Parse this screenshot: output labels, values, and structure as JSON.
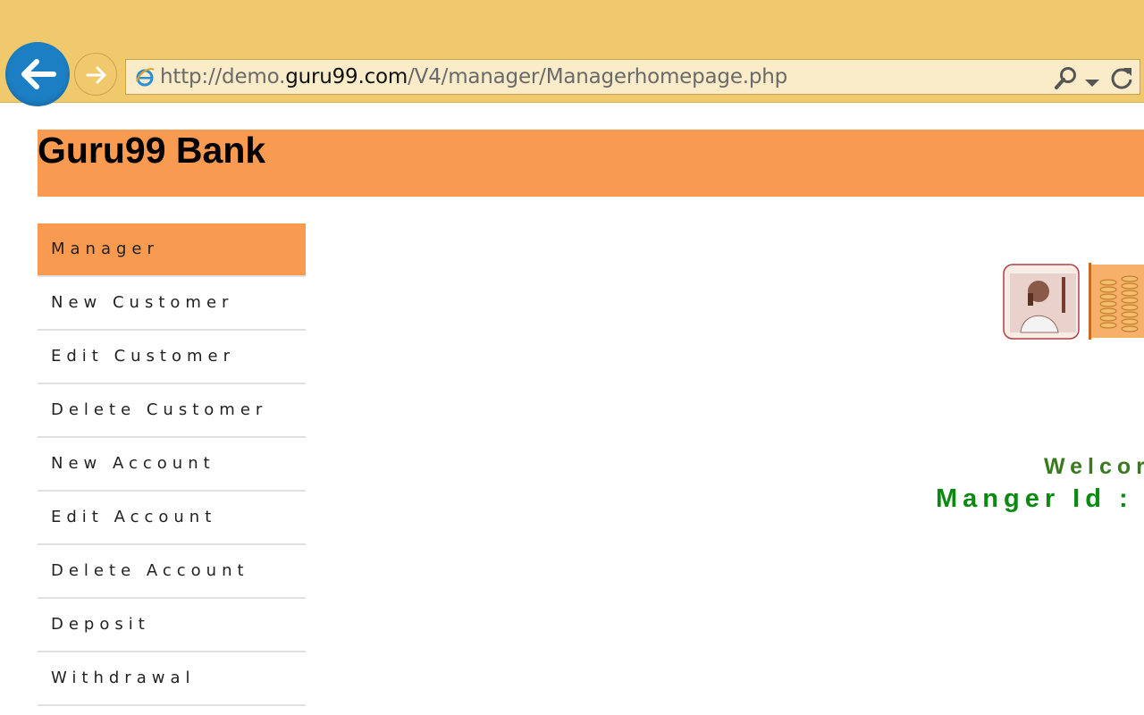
{
  "browser": {
    "url_prefix": "http://demo.",
    "url_domain": "guru99.com",
    "url_path": "/V4/manager/Managerhomepage.php",
    "chrome_color": "#f0c96d"
  },
  "header": {
    "title": "Guru99 Bank",
    "bg_color": "#f89a50"
  },
  "sidebar": {
    "items": [
      {
        "label": "Manager",
        "active": true
      },
      {
        "label": "New Customer"
      },
      {
        "label": "Edit Customer"
      },
      {
        "label": "Delete Customer"
      },
      {
        "label": "New Account"
      },
      {
        "label": "Edit Account"
      },
      {
        "label": "Delete Account"
      },
      {
        "label": "Deposit"
      },
      {
        "label": "Withdrawal"
      }
    ]
  },
  "main": {
    "welcome_text": "Welcor",
    "manager_id_text": "Manger Id : r"
  }
}
